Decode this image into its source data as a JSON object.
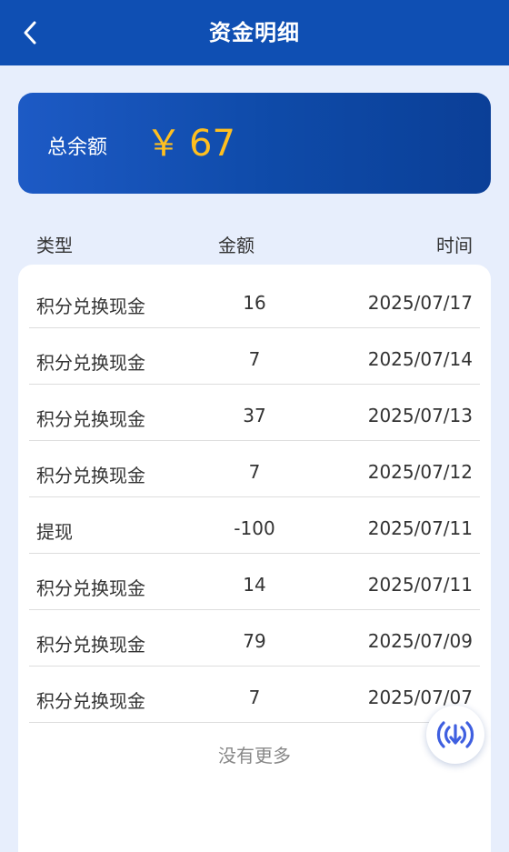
{
  "header": {
    "title": "资金明细",
    "back_icon": "chevron-left-icon"
  },
  "balance": {
    "label": "总余额",
    "currency": "￥",
    "amount": "67",
    "amount_color": "#ffbf1f"
  },
  "columns": {
    "type": "类型",
    "amount": "金额",
    "time": "时间"
  },
  "records": [
    {
      "type": "积分兑换现金",
      "amount": "16",
      "time": "2025/07/17"
    },
    {
      "type": "积分兑换现金",
      "amount": "7",
      "time": "2025/07/14"
    },
    {
      "type": "积分兑换现金",
      "amount": "37",
      "time": "2025/07/13"
    },
    {
      "type": "积分兑换现金",
      "amount": "7",
      "time": "2025/07/12"
    },
    {
      "type": "提现",
      "amount": "-100",
      "time": "2025/07/11"
    },
    {
      "type": "积分兑换现金",
      "amount": "14",
      "time": "2025/07/11"
    },
    {
      "type": "积分兑换现金",
      "amount": "79",
      "time": "2025/07/09"
    },
    {
      "type": "积分兑换现金",
      "amount": "7",
      "time": "2025/07/07"
    }
  ],
  "footer": {
    "no_more": "没有更多"
  },
  "float_button": {
    "icon": "download-broadcast-icon"
  }
}
